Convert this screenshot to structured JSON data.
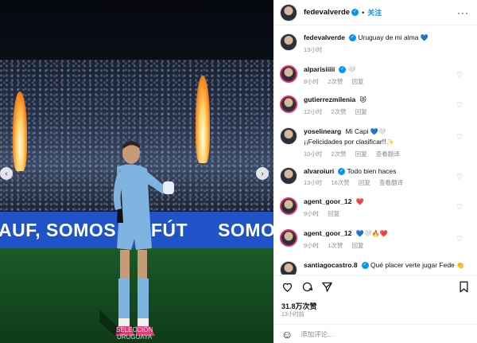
{
  "photo": {
    "banner_text_left": "AUF, SOMOS EL FÚT",
    "banner_text_right": "SOMOS AUF, SOM",
    "watermark_line1": "SELECCIÓN",
    "watermark_line2": "URUGUAYA"
  },
  "header": {
    "username": "fedevalverde",
    "follow_label": "关注",
    "more_label": "···"
  },
  "caption": {
    "username": "fedevalverde",
    "text": "Uruguay de mi alma",
    "emoji": "💙",
    "time": "13小时"
  },
  "comments": [
    {
      "username": "alparisiiiii",
      "text": "",
      "emoji": "🤍",
      "time": "8小时",
      "likes": "2次赞",
      "reply": "回复",
      "view_replies": ""
    },
    {
      "username": "gutierrezmilenia",
      "text": "",
      "emoji": "😻",
      "time": "12小时",
      "likes": "2次赞",
      "reply": "回复",
      "view_replies": ""
    },
    {
      "username": "yoselinearg",
      "text": "Mi Capi",
      "emoji": "💙🤍",
      "text2": "¡¡Felicidades por clasificar!!",
      "emoji2": "✨",
      "time": "10小时",
      "likes": "2次赞",
      "reply": "回复",
      "view_replies": "查看翻译"
    },
    {
      "username": "alvaroiuri",
      "text": "Todo bien haces",
      "emoji": "",
      "time": "13小时",
      "likes": "16次赞",
      "reply": "回复",
      "view_replies": "查看翻译"
    },
    {
      "username": "agent_goor_12",
      "text": "",
      "emoji": "❤️",
      "time": "9小时",
      "likes": "",
      "reply": "回复",
      "view_replies": ""
    },
    {
      "username": "agent_goor_12",
      "text": "",
      "emoji": "💙🤍🔥❤️",
      "time": "9小时",
      "likes": "1次赞",
      "reply": "回复",
      "view_replies": ""
    },
    {
      "username": "santiagocastro.8",
      "text": "Qué placer verte jugar Fede",
      "emoji": "👏",
      "time": "",
      "likes": "",
      "reply": "",
      "view_replies": ""
    }
  ],
  "actions": {
    "like_icon": "heart-icon",
    "comment_icon": "comment-icon",
    "share_icon": "share-icon",
    "save_icon": "bookmark-icon",
    "likes_count": "31.8万次赞",
    "time_ago": "13小时前"
  },
  "add_comment": {
    "placeholder": "添加评论..."
  },
  "colors": {
    "accent": "#0095f6",
    "banner": "#1f53c7",
    "muted": "#8e8e8e"
  }
}
